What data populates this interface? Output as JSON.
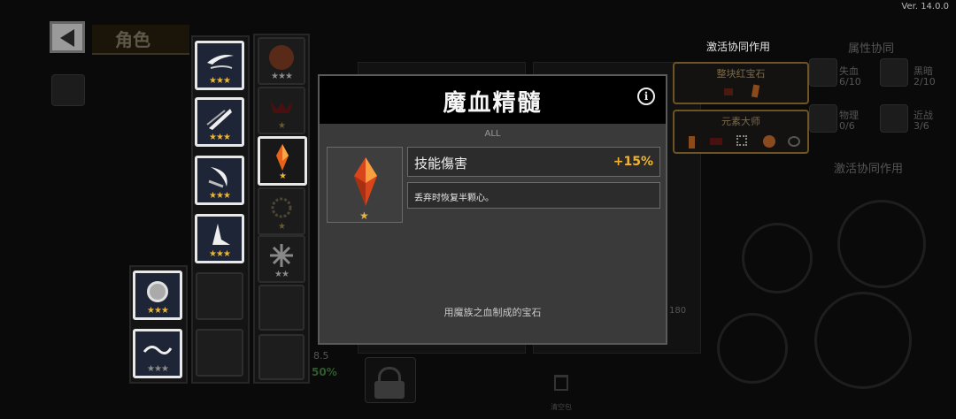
{
  "header": {
    "tab_label": "角色",
    "version": "Ver. 14.0.0"
  },
  "right_panel": {
    "synergy_title": "激活协同作用",
    "attribute_title": "属性协同",
    "synergy_title_2": "激活协同作用",
    "synergies": [
      {
        "name": "整块红宝石"
      },
      {
        "name": "元素大师"
      }
    ],
    "attributes": [
      {
        "name": "失血",
        "count": "6/10"
      },
      {
        "name": "黑暗",
        "count": "2/10"
      },
      {
        "name": "物理",
        "count": "0/6"
      },
      {
        "name": "近战",
        "count": "3/6"
      }
    ]
  },
  "background": {
    "stat_value": "8.5",
    "percent": "50%",
    "level": "180",
    "trash_label": "清空包"
  },
  "modal": {
    "title": "魔血精髓",
    "info_icon": "i",
    "category": "ALL",
    "stat_name": "技能傷害",
    "stat_value": "+15%",
    "description": "丢弃时恢复半颗心。",
    "flavor": "用魔族之血制成的宝石",
    "item_stars": "★"
  },
  "inventory": {
    "weapon_stars": [
      "★★★",
      "★★★",
      "★★★",
      "★★★"
    ],
    "gem_column_stars": [
      "★★★",
      "★",
      "★",
      "★",
      "★★"
    ],
    "bottom_stars": [
      "★★★",
      "★★★"
    ]
  },
  "colors": {
    "accent_gold": "#f0b432",
    "modal_bg": "#3a3a3a",
    "synergy_border": "#6e5324"
  }
}
